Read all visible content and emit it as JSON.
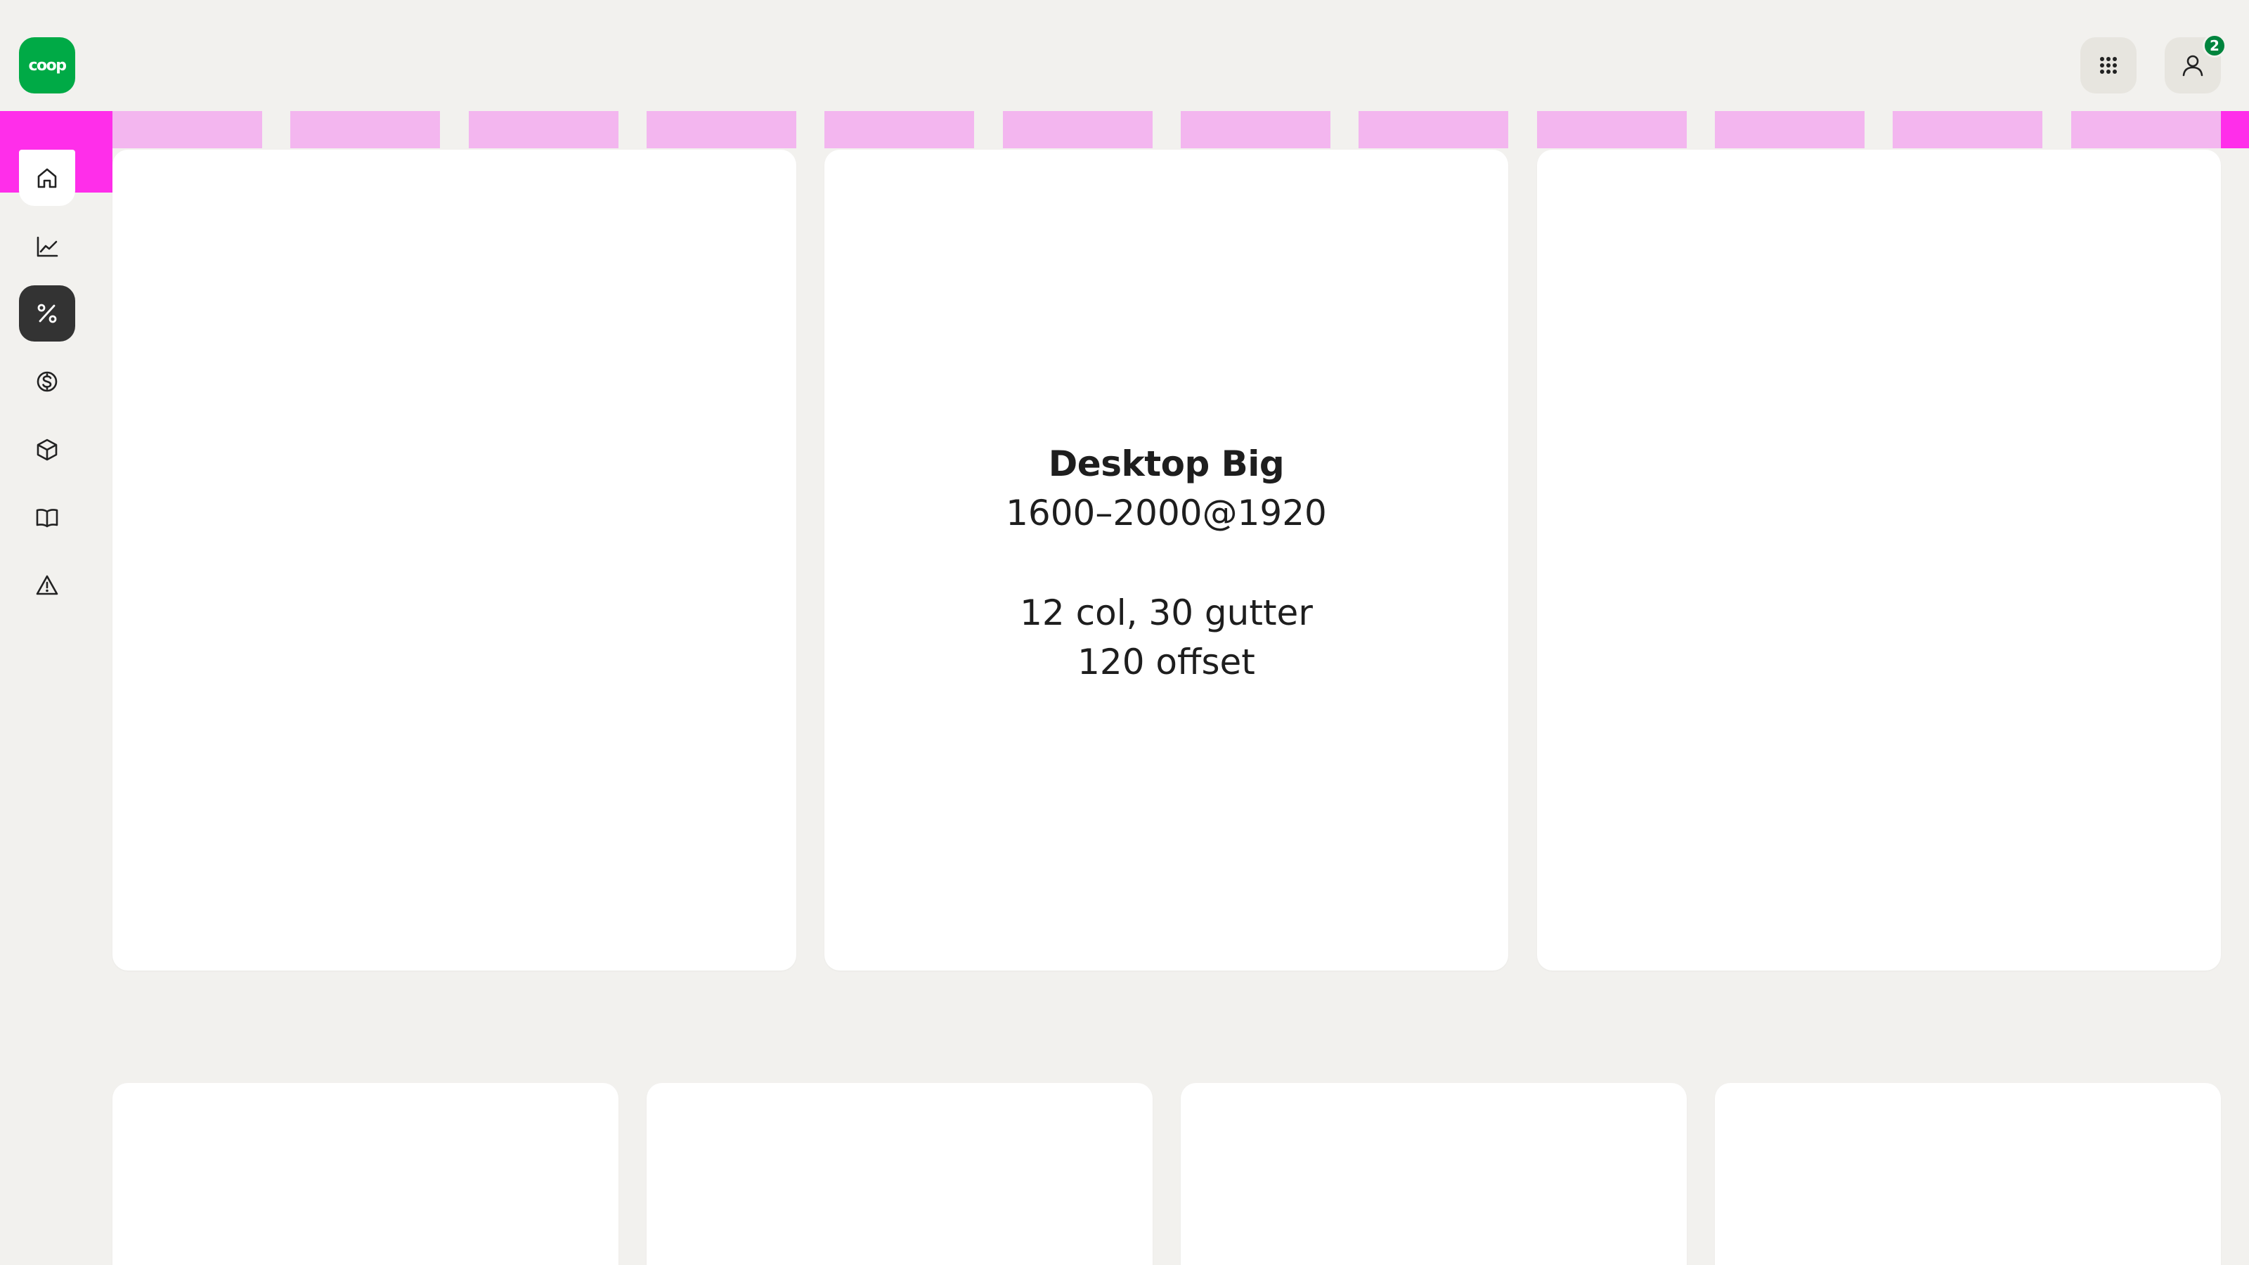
{
  "app": {
    "logo_text": "coop",
    "brand_color": "#00aa46",
    "notification_count": "2"
  },
  "header": {
    "apps_icon": "grid-dots-icon",
    "user_icon": "user-icon"
  },
  "sidebar": {
    "items": [
      {
        "icon": "home-icon",
        "state": "current"
      },
      {
        "icon": "chart-line-icon"
      },
      {
        "icon": "percent-icon",
        "state": "active"
      },
      {
        "icon": "dollar-coin-icon"
      },
      {
        "icon": "box-icon"
      },
      {
        "icon": "book-icon"
      },
      {
        "icon": "warning-icon"
      }
    ]
  },
  "grid_overlay": {
    "columns": 12,
    "column_color": "#f3b6ef",
    "offset_color": "#ff2eea"
  },
  "main": {
    "card_title": "Desktop Big",
    "card_subtitle": "1600–2000@1920",
    "card_line_1": "12 col, 30 gutter",
    "card_line_2": "120 offset"
  }
}
